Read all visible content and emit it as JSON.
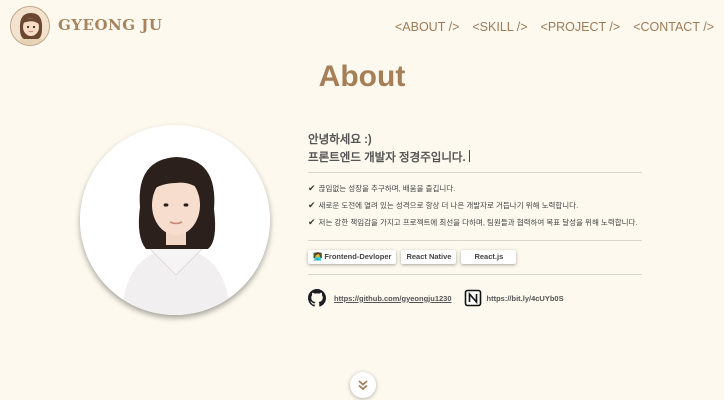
{
  "header": {
    "logo_text": "GYEONG JU",
    "nav": [
      "<ABOUT />",
      "<SKILL />",
      "<PROJECT />",
      "<CONTACT />"
    ]
  },
  "page_title": "About",
  "intro": {
    "greeting": "안녕하세요 :)",
    "headline": "프론트엔드 개발자 정경주입니다."
  },
  "bullets": [
    "끊임없는 성장을 추구하며, 배움을 즐깁니다.",
    "새로운 도전에 열려 있는 성격으로 항상 더 나은 개발자로 거듭나기 위해 노력합니다.",
    "저는 강한 책임감을 가지고 프로젝트에 최선을 다하며, 팀원들과 협력하여 목표 달성을 위해 노력합니다."
  ],
  "tags": {
    "frontend_emoji": "👩‍💻",
    "frontend": "Frontend-Devloper",
    "react_native": "React Native",
    "react": "React.js"
  },
  "links": {
    "github": "https://github.com/gyeongju1230",
    "notion": "https://bit.ly/4cUYb0S"
  },
  "icons": {
    "check": "check-icon",
    "github": "github-icon",
    "notion": "notion-icon",
    "scroll": "double-chevron-down-icon"
  },
  "colors": {
    "background": "#fdf9ee",
    "accent": "#a57f57",
    "nav": "#9c7b58"
  }
}
